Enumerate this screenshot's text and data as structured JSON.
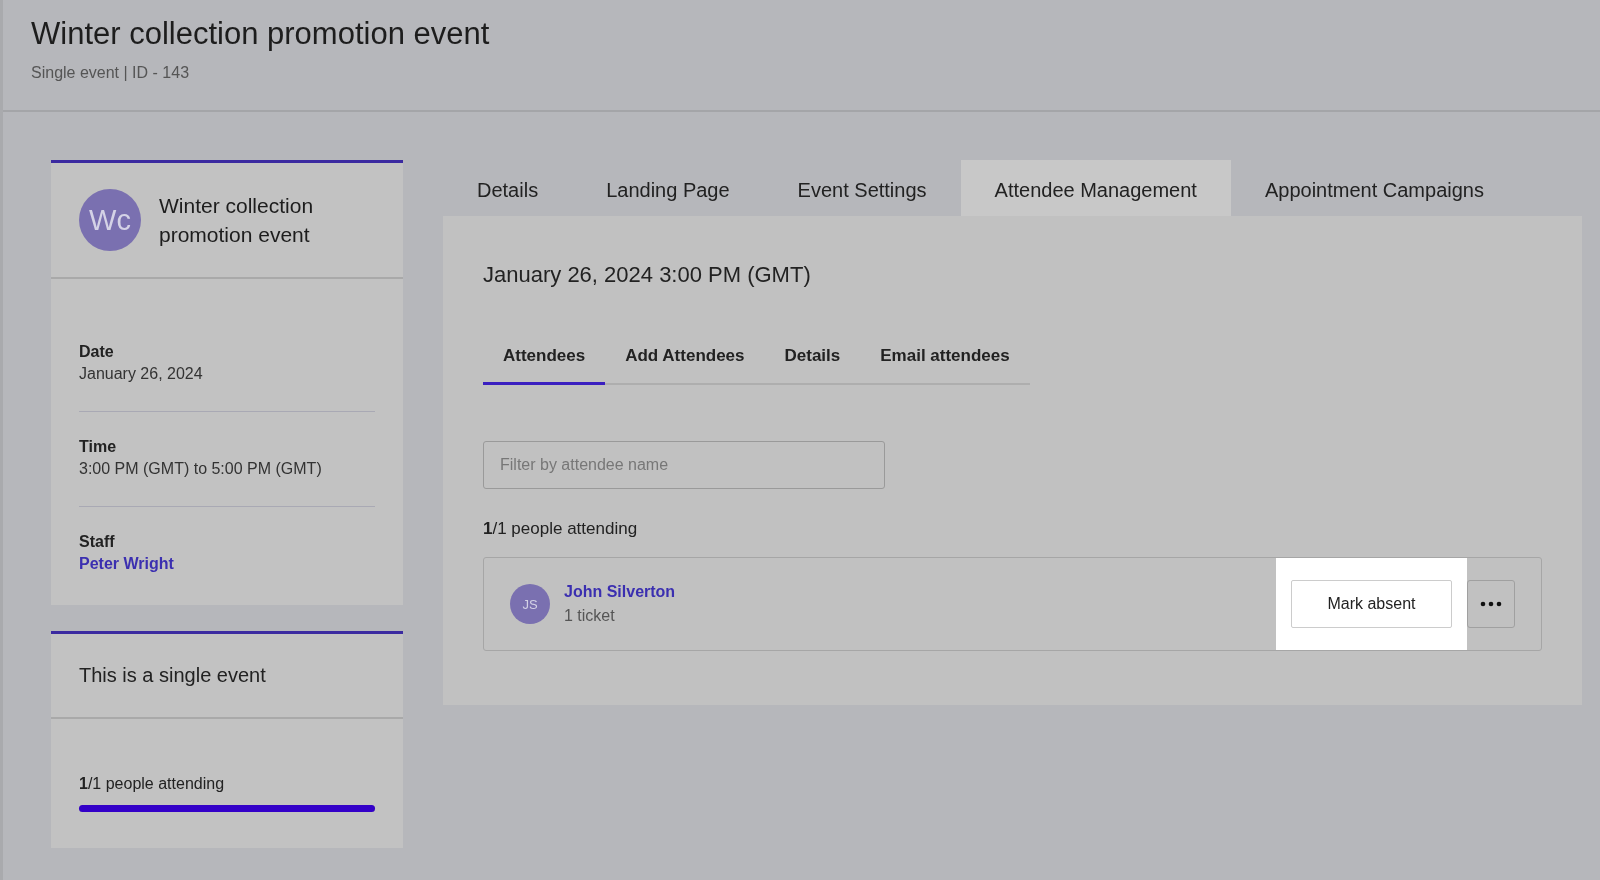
{
  "header": {
    "title": "Winter collection promotion event",
    "subtitle": "Single event | ID - 143"
  },
  "summary_card": {
    "avatar_initials": "Wc",
    "title": "Winter collection promotion event",
    "details": [
      {
        "label": "Date",
        "value": "January 26, 2024",
        "kind": "text"
      },
      {
        "label": "Time",
        "value": "3:00 PM (GMT) to 5:00 PM (GMT)",
        "kind": "text"
      },
      {
        "label": "Staff",
        "value": "Peter Wright",
        "kind": "link"
      }
    ]
  },
  "info_card": {
    "text": "This is a single event",
    "attending": "**1**/1 people attending",
    "level": 1
  },
  "tabs": [
    {
      "label": "Details",
      "selected": false
    },
    {
      "label": "Landing Page",
      "selected": false
    },
    {
      "label": "Event Settings",
      "selected": false
    },
    {
      "label": "Attendee Management",
      "selected": true
    },
    {
      "label": "Appointment Campaigns",
      "selected": false
    }
  ],
  "panel": {
    "datetime": "January 26, 2024 3:00 PM (GMT)",
    "subtabs": [
      {
        "label": "Attendees",
        "selected": true
      },
      {
        "label": "Add Attendees",
        "selected": false
      },
      {
        "label": "Details",
        "selected": false
      },
      {
        "label": "Email attendees",
        "selected": false
      }
    ],
    "filter": {
      "placeholder": "Filter by attendee name"
    },
    "attending_count": "**1**/1 people attending",
    "attendees": [
      {
        "initials": "JS",
        "name": "John Silverton",
        "tickets": "1 ticket",
        "action": "Mark absent",
        "highlighted": true
      }
    ]
  }
}
